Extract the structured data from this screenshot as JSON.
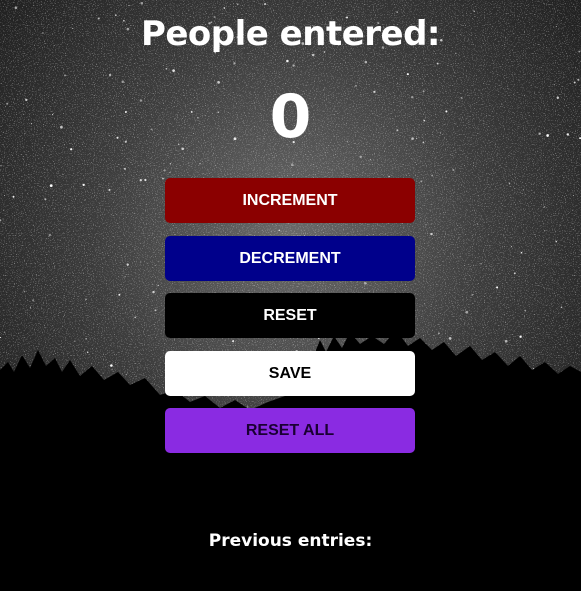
{
  "header": {
    "title": "People entered:"
  },
  "counter": {
    "value": "0"
  },
  "buttons": {
    "increment": "INCREMENT",
    "decrement": "DECREMENT",
    "reset": "RESET",
    "save": "SAVE",
    "reset_all": "RESET ALL"
  },
  "entries": {
    "label": "Previous entries:",
    "items": ""
  },
  "colors": {
    "increment": "#8b0000",
    "decrement": "#00008b",
    "reset": "#000000",
    "save": "#ffffff",
    "reset_all": "#8a2be2"
  }
}
